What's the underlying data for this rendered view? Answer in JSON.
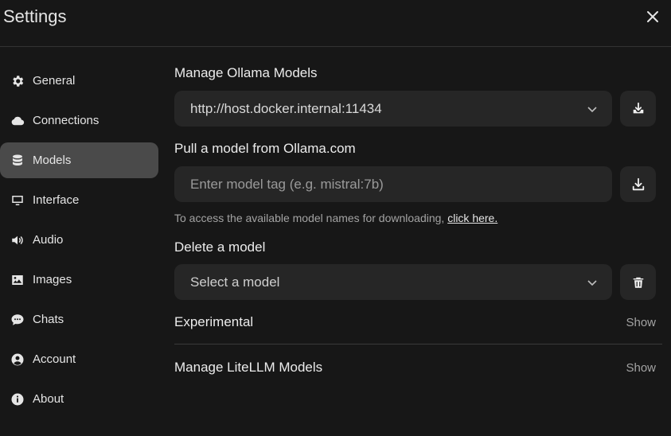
{
  "dialog": {
    "title": "Settings"
  },
  "sidebar": {
    "items": [
      {
        "label": "General",
        "icon": "gear-icon"
      },
      {
        "label": "Connections",
        "icon": "cloud-icon"
      },
      {
        "label": "Models",
        "icon": "database-icon",
        "active": true
      },
      {
        "label": "Interface",
        "icon": "monitor-icon"
      },
      {
        "label": "Audio",
        "icon": "speaker-icon"
      },
      {
        "label": "Images",
        "icon": "image-icon"
      },
      {
        "label": "Chats",
        "icon": "chat-bubble-icon"
      },
      {
        "label": "Account",
        "icon": "user-circle-icon"
      },
      {
        "label": "About",
        "icon": "info-icon"
      }
    ]
  },
  "ollama": {
    "manage_title": "Manage Ollama Models",
    "server_url": "http://host.docker.internal:11434",
    "pull_title": "Pull a model from Ollama.com",
    "pull_placeholder": "Enter model tag (e.g. mistral:7b)",
    "hint_text": "To access the available model names for downloading,",
    "hint_link": "click here.",
    "delete_title": "Delete a model",
    "delete_placeholder": "Select a model"
  },
  "experimental": {
    "title": "Experimental",
    "toggle": "Show"
  },
  "litellm": {
    "title": "Manage LiteLLM Models",
    "toggle": "Show"
  },
  "colors": {
    "background": "#171717",
    "field": "#262626",
    "active_nav": "#4a4a4a",
    "muted_text": "#a3a3a3"
  }
}
